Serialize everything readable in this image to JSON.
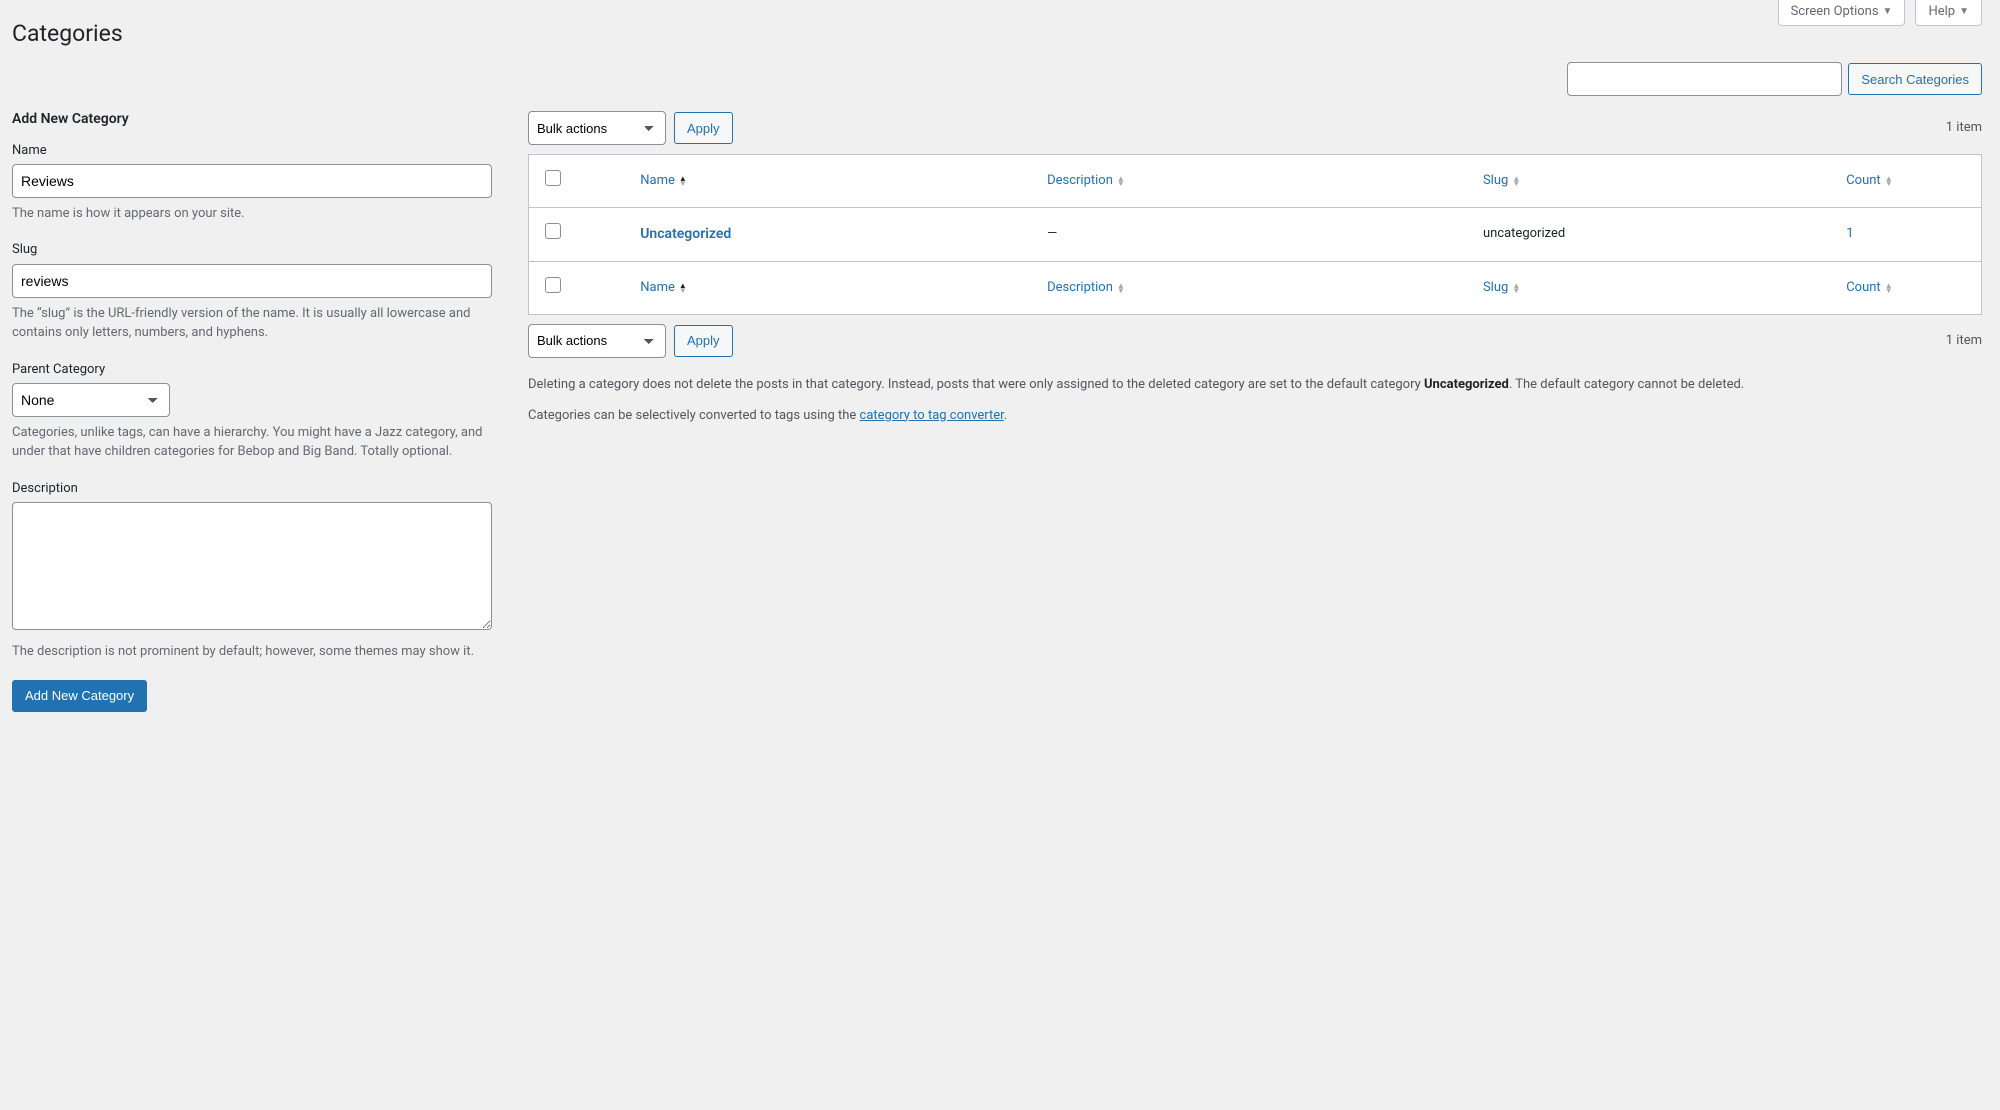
{
  "topTabs": {
    "screenOptions": "Screen Options",
    "help": "Help"
  },
  "pageTitle": "Categories",
  "search": {
    "value": "",
    "button": "Search Categories"
  },
  "form": {
    "title": "Add New Category",
    "name": {
      "label": "Name",
      "value": "Reviews",
      "help": "The name is how it appears on your site."
    },
    "slug": {
      "label": "Slug",
      "value": "reviews",
      "help": "The “slug” is the URL-friendly version of the name. It is usually all lowercase and contains only letters, numbers, and hyphens."
    },
    "parent": {
      "label": "Parent Category",
      "selected": "None",
      "help": "Categories, unlike tags, can have a hierarchy. You might have a Jazz category, and under that have children categories for Bebop and Big Band. Totally optional."
    },
    "description": {
      "label": "Description",
      "value": "",
      "help": "The description is not prominent by default; however, some themes may show it."
    },
    "submit": "Add New Category"
  },
  "bulk": {
    "selected": "Bulk actions",
    "apply": "Apply"
  },
  "pagination": {
    "count": "1 item"
  },
  "columns": {
    "name": "Name",
    "description": "Description",
    "slug": "Slug",
    "count": "Count"
  },
  "rows": [
    {
      "name": "Uncategorized",
      "description": "—",
      "slug": "uncategorized",
      "count": "1"
    }
  ],
  "notes": {
    "p1_a": "Deleting a category does not delete the posts in that category. Instead, posts that were only assigned to the deleted category are set to the default category ",
    "p1_strong": "Uncategorized",
    "p1_b": ". The default category cannot be deleted.",
    "p2_a": "Categories can be selectively converted to tags using the ",
    "p2_link": "category to tag converter",
    "p2_b": "."
  }
}
